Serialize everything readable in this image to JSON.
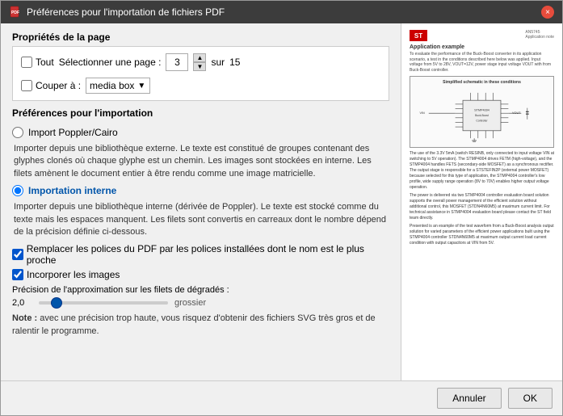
{
  "titlebar": {
    "title": "Préférences pour l'importation de fichiers PDF",
    "close_label": "×"
  },
  "page_properties": {
    "section_title": "Propriétés de la page",
    "all_label": "Tout",
    "select_page_label": "Sélectionner une page :",
    "page_value": "3",
    "of_label": "sur",
    "total_pages": "15",
    "crop_label": "Couper à :",
    "crop_option": "media box"
  },
  "import_prefs": {
    "section_title": "Préférences pour l'importation",
    "poppler_label": "Import Poppler/Cairo",
    "poppler_description": "Importer depuis une bibliothèque externe. Le texte est constitué de groupes contenant des glyphes clonés où chaque glyphe est un chemin. Les images sont stockées en interne. Les filets amènent le document entier à être rendu comme une image matricielle.",
    "internal_label": "Importation interne",
    "internal_description": "Importer depuis une bibliothèque interne (dérivée de Poppler). Le texte est stocké comme du texte mais les espaces manquent. Les filets sont convertis en carreaux dont le nombre dépend de la précision définie ci-dessous.",
    "replace_fonts_label": "Remplacer les polices du PDF par les polices installées dont le nom est le plus proche",
    "embed_images_label": "Incorporer les images",
    "precision_label": "Précision de l'approximation sur les filets de dégradés :",
    "precision_value": "2,0",
    "slider_min": 0,
    "slider_max": 10,
    "slider_current": 1,
    "slider_end_label": "grossier",
    "note_text": "Note : avec une précision trop haute, vous risquez d'obtenir des fichiers SVG très gros et de ralentir le programme."
  },
  "footer": {
    "cancel_label": "Annuler",
    "ok_label": "OK"
  },
  "pdf_preview": {
    "logo_text": "ST",
    "doc_number": "AN5745\nApplication note",
    "section_title": "Application example"
  }
}
